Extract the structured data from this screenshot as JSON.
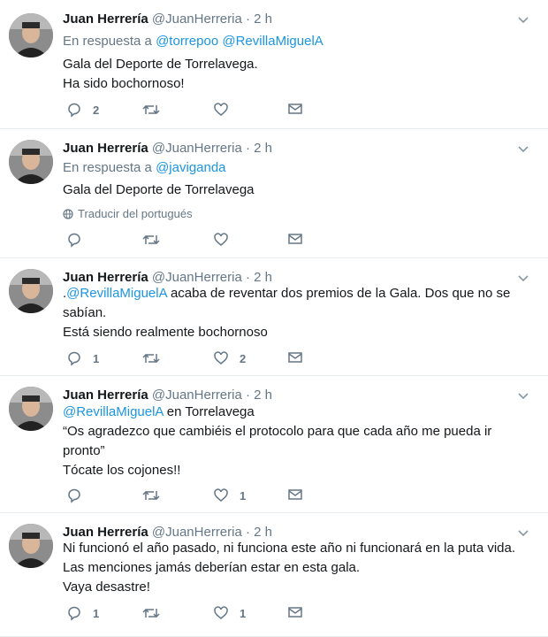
{
  "tweets": [
    {
      "name": "Juan Herrería",
      "handle": "@JuanHerreria",
      "dot": "·",
      "time": "2 h",
      "reply_prefix": "En respuesta a",
      "reply_to_1": "@torrepoo",
      "reply_to_2": "@RevillaMiguelA",
      "line1": "Gala del Deporte de Torrelavega.",
      "line2": "Ha sido bochornoso!",
      "replies": "2",
      "retweets": "",
      "likes": ""
    },
    {
      "name": "Juan Herrería",
      "handle": "@JuanHerreria",
      "dot": "·",
      "time": "2 h",
      "reply_prefix": "En respuesta a",
      "reply_to_1": "@javiganda",
      "line1": "Gala del Deporte de Torrelavega",
      "translate": "Traducir del portugués",
      "replies": "",
      "retweets": "",
      "likes": ""
    },
    {
      "name": "Juan Herrería",
      "handle": "@JuanHerreria",
      "dot": "·",
      "time": "2 h",
      "line1_prefix": ".",
      "mention": "@RevillaMiguelA",
      "line1_rest": " acaba de reventar dos premios de la Gala. Dos que no se",
      "line2": "sabían.",
      "line3": "Está siendo realmente bochornoso",
      "replies": "1",
      "retweets": "",
      "likes": "2"
    },
    {
      "name": "Juan Herrería",
      "handle": "@JuanHerreria",
      "dot": "·",
      "time": "2 h",
      "mention": "@RevillaMiguelA",
      "line1_rest": " en Torrelavega",
      "line2": "“Os agradezco que cambiéis el protocolo para que cada año me pueda ir",
      "line3": "pronto”",
      "line4": "Tócate los cojones!!",
      "replies": "",
      "retweets": "",
      "likes": "1"
    },
    {
      "name": "Juan Herrería",
      "handle": "@JuanHerreria",
      "dot": "·",
      "time": "2 h",
      "line1": "Ni funcionó el año pasado, ni funciona este año ni funcionará en la puta vida.",
      "line2": "Las menciones jamás deberían estar en esta gala.",
      "line3": "Vaya desastre!",
      "replies": "1",
      "retweets": "",
      "likes": "1"
    }
  ],
  "colors": {
    "link": "#1b95e0",
    "muted": "#657786",
    "text": "#14171a",
    "border": "#e6ecf0"
  },
  "icons": {
    "reply": "reply-icon",
    "retweet": "retweet-icon",
    "like": "heart-icon",
    "dm": "envelope-icon",
    "caret": "chevron-down-icon",
    "translate": "globe-icon"
  }
}
